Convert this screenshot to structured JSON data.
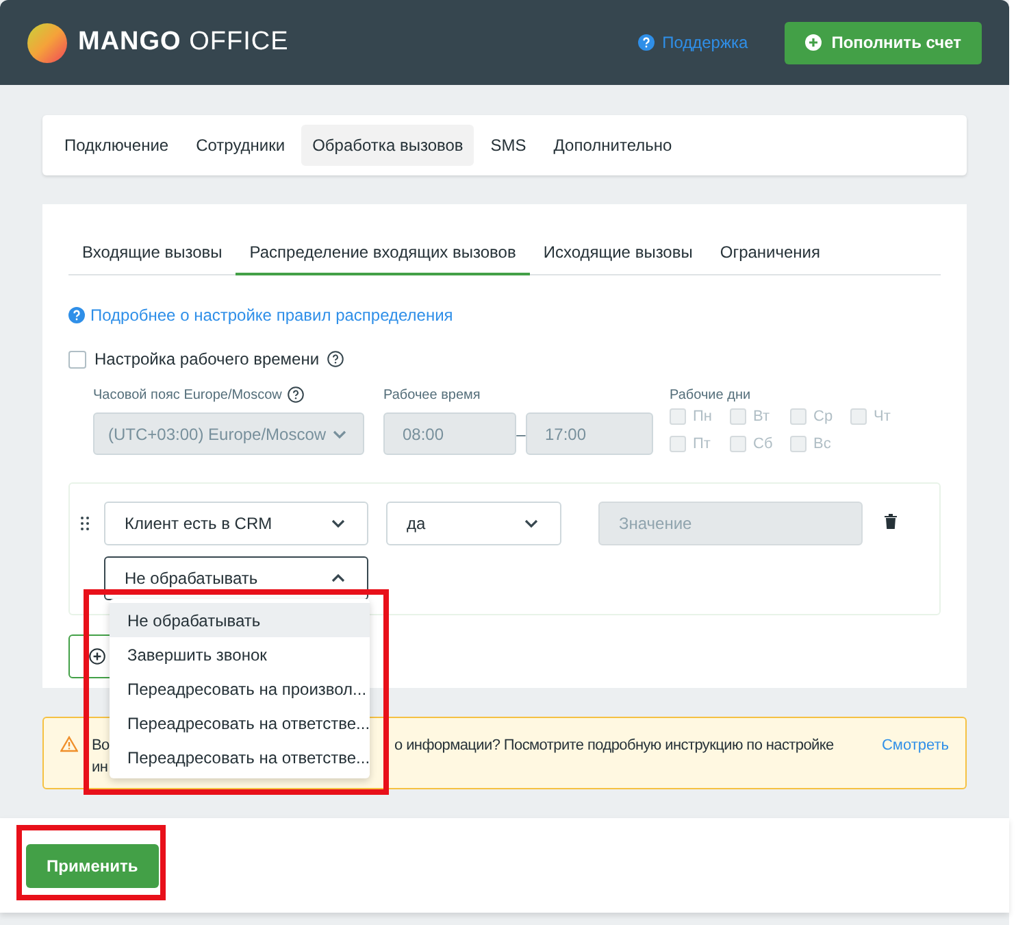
{
  "header": {
    "logo": {
      "bold": "MANGO",
      "light": "OFFICE"
    },
    "support_link": "Поддержка",
    "topup_button": "Пополнить счет"
  },
  "nav_tabs": [
    {
      "label": "Подключение",
      "selected": false
    },
    {
      "label": "Сотрудники",
      "selected": false
    },
    {
      "label": "Обработка вызовов",
      "selected": true
    },
    {
      "label": "SMS",
      "selected": false
    },
    {
      "label": "Дополнительно",
      "selected": false
    }
  ],
  "sub_tabs": [
    {
      "label": "Входящие вызовы",
      "selected": false
    },
    {
      "label": "Распределение входящих вызовов",
      "selected": true
    },
    {
      "label": "Исходящие вызовы",
      "selected": false
    },
    {
      "label": "Ограничения",
      "selected": false
    }
  ],
  "help_link": "Подробнее о настройке правил распределения",
  "work_time": {
    "label": "Настройка рабочего времени",
    "checked": false,
    "timezone": {
      "label": "Часовой пояс Europe/Moscow",
      "value": "(UTC+03:00) Europe/Moscow"
    },
    "hours": {
      "label": "Рабочее время",
      "from": "08:00",
      "separator": "–",
      "to": "17:00"
    },
    "days": {
      "label": "Рабочие дни",
      "items": [
        {
          "label": "Пн",
          "checked": false
        },
        {
          "label": "Вт",
          "checked": false
        },
        {
          "label": "Ср",
          "checked": false
        },
        {
          "label": "Чт",
          "checked": false
        },
        {
          "label": "Пт",
          "checked": false
        },
        {
          "label": "Сб",
          "checked": false
        },
        {
          "label": "Вс",
          "checked": false
        }
      ]
    }
  },
  "rule": {
    "condition": "Клиент есть в CRM",
    "operator": "да",
    "value_placeholder": "Значение",
    "action": {
      "value": "Не обрабатывать",
      "expanded": true,
      "options": [
        {
          "label": "Не обрабатывать",
          "selected": true
        },
        {
          "label": "Завершить звонок",
          "selected": false
        },
        {
          "label": "Переадресовать на произвол...",
          "selected": false
        },
        {
          "label": "Переадресовать на ответстве...",
          "selected": false
        },
        {
          "label": "Переадресовать на ответстве...",
          "selected": false
        }
      ]
    }
  },
  "warning": {
    "line1_start": "Во",
    "line1_end": "о информации? Посмотрите подробную инструкцию по настройке",
    "line2_start": "ин",
    "link": "Смотреть"
  },
  "apply_button": "Применить"
}
